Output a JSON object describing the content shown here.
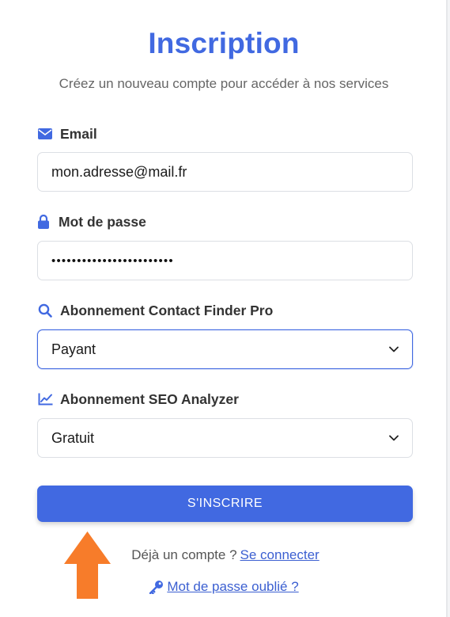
{
  "header": {
    "title": "Inscription",
    "subtitle": "Créez un nouveau compte pour accéder à nos services"
  },
  "form": {
    "email": {
      "label": "Email",
      "icon": "envelope-icon",
      "value": "mon.adresse@mail.fr"
    },
    "password": {
      "label": "Mot de passe",
      "icon": "lock-icon",
      "value": "••••••••••••••••••••••••"
    },
    "contact_finder": {
      "label": "Abonnement Contact Finder Pro",
      "icon": "search-icon",
      "selected": "Payant"
    },
    "seo_analyzer": {
      "label": "Abonnement SEO Analyzer",
      "icon": "chart-line-icon",
      "selected": "Gratuit"
    },
    "submit_label": "S'INSCRIRE"
  },
  "footer": {
    "login_prompt": "Déjà un compte ?",
    "login_link": "Se connecter",
    "forgot_link": "Mot de passe oublié ?",
    "forgot_icon": "key-icon"
  },
  "colors": {
    "accent": "#4169e1",
    "arrow": "#f77c2a",
    "link": "#3b5fd1"
  },
  "overlay": {
    "arrow_icon": "up-arrow-icon"
  }
}
